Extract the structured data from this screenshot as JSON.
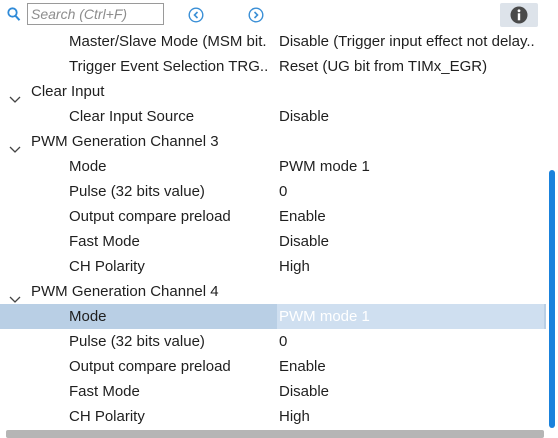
{
  "search": {
    "placeholder": "Search (Ctrl+F)"
  },
  "toolbar": {
    "prev_icon": "arrow-left-circle-icon",
    "next_icon": "arrow-right-circle-icon",
    "info_icon": "info-icon"
  },
  "rows": [
    {
      "kind": "prop",
      "label": "Master/Slave Mode (MSM bit.",
      "value": "Disable (Trigger input effect not delay.."
    },
    {
      "kind": "prop",
      "label": "Trigger Event Selection TRG..",
      "value": "Reset (UG bit from TIMx_EGR)"
    },
    {
      "kind": "group",
      "label": "Clear Input"
    },
    {
      "kind": "prop",
      "label": "Clear Input Source",
      "value": "Disable"
    },
    {
      "kind": "group",
      "label": "PWM Generation Channel 3"
    },
    {
      "kind": "prop",
      "label": "Mode",
      "value": "PWM mode 1"
    },
    {
      "kind": "prop",
      "label": "Pulse (32 bits value)",
      "value": "0"
    },
    {
      "kind": "prop",
      "label": "Output compare preload",
      "value": "Enable"
    },
    {
      "kind": "prop",
      "label": "Fast Mode",
      "value": "Disable"
    },
    {
      "kind": "prop",
      "label": "CH Polarity",
      "value": "High"
    },
    {
      "kind": "group",
      "label": "PWM Generation Channel 4"
    },
    {
      "kind": "prop",
      "label": "Mode",
      "value": "PWM mode 1",
      "selected": true
    },
    {
      "kind": "prop",
      "label": "Pulse (32 bits value)",
      "value": "0"
    },
    {
      "kind": "prop",
      "label": "Output compare preload",
      "value": "Enable"
    },
    {
      "kind": "prop",
      "label": "Fast Mode",
      "value": "Disable"
    },
    {
      "kind": "prop",
      "label": "CH Polarity",
      "value": "High"
    }
  ],
  "colors": {
    "accent": "#1a82dc",
    "selection": "#b9cfe5",
    "nav_icon": "#3a8fd6"
  }
}
